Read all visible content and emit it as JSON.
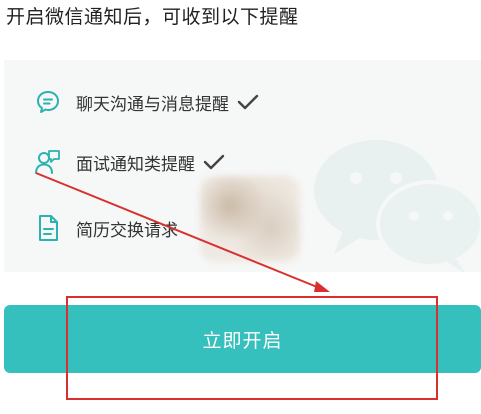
{
  "header": {
    "title": "开启微信通知后，可收到以下提醒"
  },
  "features": [
    {
      "label": "聊天沟通与消息提醒",
      "icon": "chat-bubble-icon",
      "checked": true
    },
    {
      "label": "面试通知类提醒",
      "icon": "interview-person-icon",
      "checked": true
    },
    {
      "label": "简历交换请求",
      "icon": "document-icon",
      "checked": false
    }
  ],
  "primary_button": {
    "label": "立即开启"
  },
  "colors": {
    "accent": "#35c0bd",
    "icon": "#2bb3b0",
    "panel_bg": "#f6f7f7",
    "annotation_red": "#d9302f"
  }
}
